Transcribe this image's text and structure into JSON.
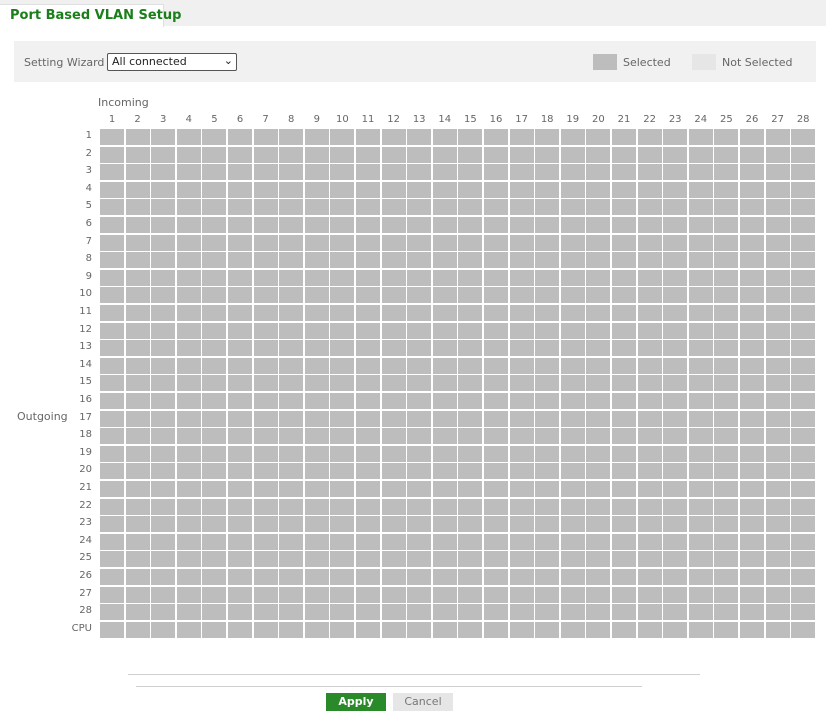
{
  "tab": {
    "title": "Port Based VLAN Setup"
  },
  "toolbar": {
    "wizard_label": "Setting Wizard",
    "wizard_value": "All connected",
    "legend_selected": "Selected",
    "legend_not_selected": "Not Selected",
    "color_selected": "#bdbdbd",
    "color_not_selected": "#e6e6e6"
  },
  "matrix": {
    "incoming_label": "Incoming",
    "outgoing_label": "Outgoing",
    "columns": [
      "1",
      "2",
      "3",
      "4",
      "5",
      "6",
      "7",
      "8",
      "9",
      "10",
      "11",
      "12",
      "13",
      "14",
      "15",
      "16",
      "17",
      "18",
      "19",
      "20",
      "21",
      "22",
      "23",
      "24",
      "25",
      "26",
      "27",
      "28"
    ],
    "rows": [
      "1",
      "2",
      "3",
      "4",
      "5",
      "6",
      "7",
      "8",
      "9",
      "10",
      "11",
      "12",
      "13",
      "14",
      "15",
      "16",
      "17",
      "18",
      "19",
      "20",
      "21",
      "22",
      "23",
      "24",
      "25",
      "26",
      "27",
      "28",
      "CPU"
    ],
    "all_selected": true
  },
  "footer": {
    "apply_label": "Apply",
    "cancel_label": "Cancel"
  }
}
